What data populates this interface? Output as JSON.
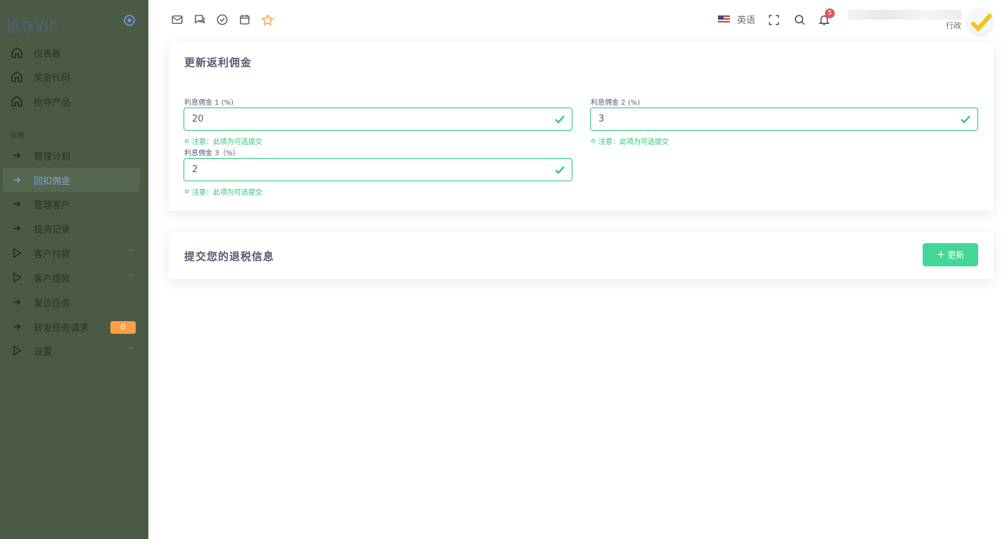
{
  "brand": {
    "name": "抢夺VIP"
  },
  "sidebar": {
    "top_items": [
      {
        "label": "仪表板",
        "icon": "home-icon"
      },
      {
        "label": "奖金代码",
        "icon": "home-icon"
      },
      {
        "label": "抢夺产品",
        "icon": "home-icon"
      }
    ],
    "section_label": "应用",
    "items": [
      {
        "label": "管理计划",
        "icon": "arrow-right-icon"
      },
      {
        "label": "回扣佣金",
        "icon": "arrow-right-icon",
        "active": true
      },
      {
        "label": "管理客户",
        "icon": "arrow-right-icon"
      },
      {
        "label": "投资记录",
        "icon": "arrow-right-icon"
      },
      {
        "label": "客户付款",
        "icon": "play-icon",
        "expandable": true
      },
      {
        "label": "客户提款",
        "icon": "play-icon",
        "expandable": true
      },
      {
        "label": "复诊任务",
        "icon": "arrow-right-icon"
      },
      {
        "label": "转发任务请求",
        "icon": "arrow-right-icon",
        "badge": "0"
      },
      {
        "label": "设置",
        "icon": "play-icon",
        "expandable": true
      }
    ]
  },
  "topbar": {
    "language": "英语",
    "notifications_count": "5",
    "user_role": "行政"
  },
  "card1": {
    "title": "更新返利佣金",
    "fields": [
      {
        "label": "利息佣金 1 (%)",
        "value": "20",
        "hint": "注意：此项为可选提交"
      },
      {
        "label": "利息佣金 2 (%)",
        "value": "3",
        "hint": "注意：此项为可选提交"
      },
      {
        "label": "利息佣金 3（%）",
        "value": "2",
        "hint": "注意：此项为可选提交"
      }
    ]
  },
  "card2": {
    "title": "提交您的退税信息",
    "button_label": "更新"
  },
  "colors": {
    "sidebar_bg": "#4a5a45",
    "active_text": "#7ea3e6",
    "success": "#28c76f",
    "button_bg": "#42d697",
    "badge_orange": "#ff9f43",
    "notif_red": "#ea5455"
  }
}
